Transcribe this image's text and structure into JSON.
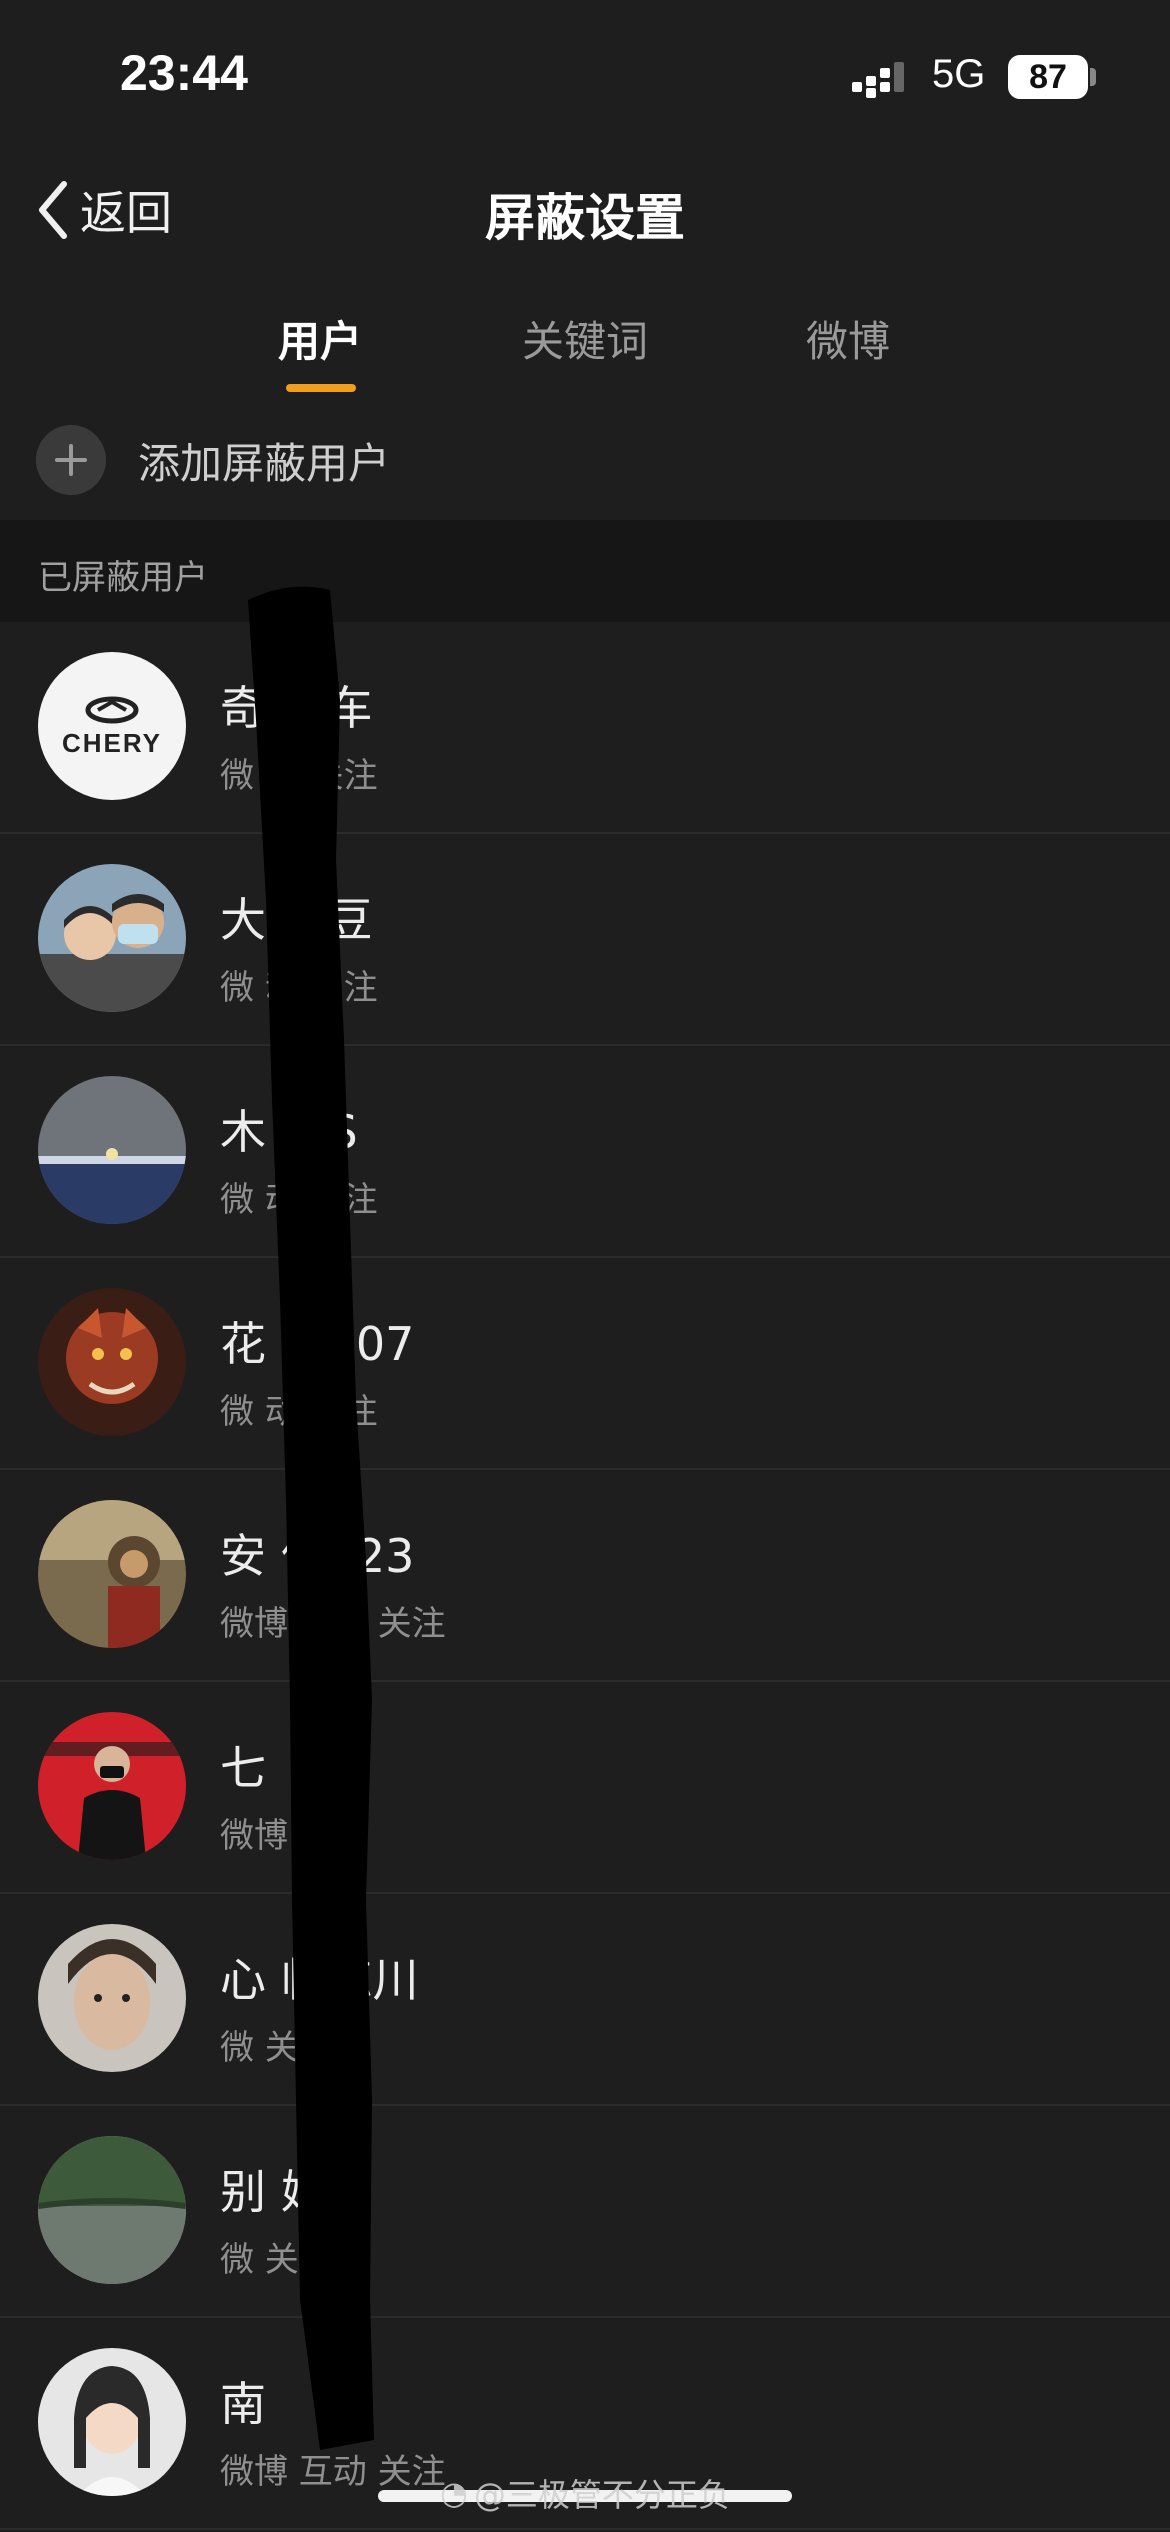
{
  "status": {
    "time": "23:44",
    "network": "5G",
    "battery": "87"
  },
  "nav": {
    "back_label": "返回",
    "title": "屏蔽设置"
  },
  "tabs": [
    {
      "label": "用户",
      "active": true
    },
    {
      "label": "关键词",
      "active": false
    },
    {
      "label": "微博",
      "active": false
    }
  ],
  "add_user": {
    "label": "添加屏蔽用户"
  },
  "section": {
    "title": "已屏蔽用户"
  },
  "users": [
    {
      "name": "奇    汽车",
      "sub": "微      动 关注",
      "avatar": "chery-logo"
    },
    {
      "name": "大    毛豆",
      "sub": "微      动 关注",
      "avatar": "couple-photo"
    },
    {
      "name": "木    ssS",
      "sub": "微      动 关注",
      "avatar": "moon-landscape"
    },
    {
      "name": "花      缺007",
      "sub": "微      动 关注",
      "avatar": "dragon"
    },
    {
      "name": "安      仔123",
      "sub": "微博 互动 关注",
      "avatar": "monkey-king"
    },
    {
      "name": "七",
      "sub": "微博        关注",
      "avatar": "red-sign-person"
    },
    {
      "name": "心      临忘川",
      "sub": "微      关注",
      "avatar": "young-man"
    },
    {
      "name": "别      娇情",
      "sub": "微      关注",
      "avatar": "forest-lake"
    },
    {
      "name": "南",
      "sub": "微博 互动 关注",
      "avatar": "anime-girl"
    }
  ],
  "watermark": "@三极管不分正负",
  "colors": {
    "accent": "#f29d1f",
    "background": "#1e1e1e",
    "section": "#161616"
  }
}
